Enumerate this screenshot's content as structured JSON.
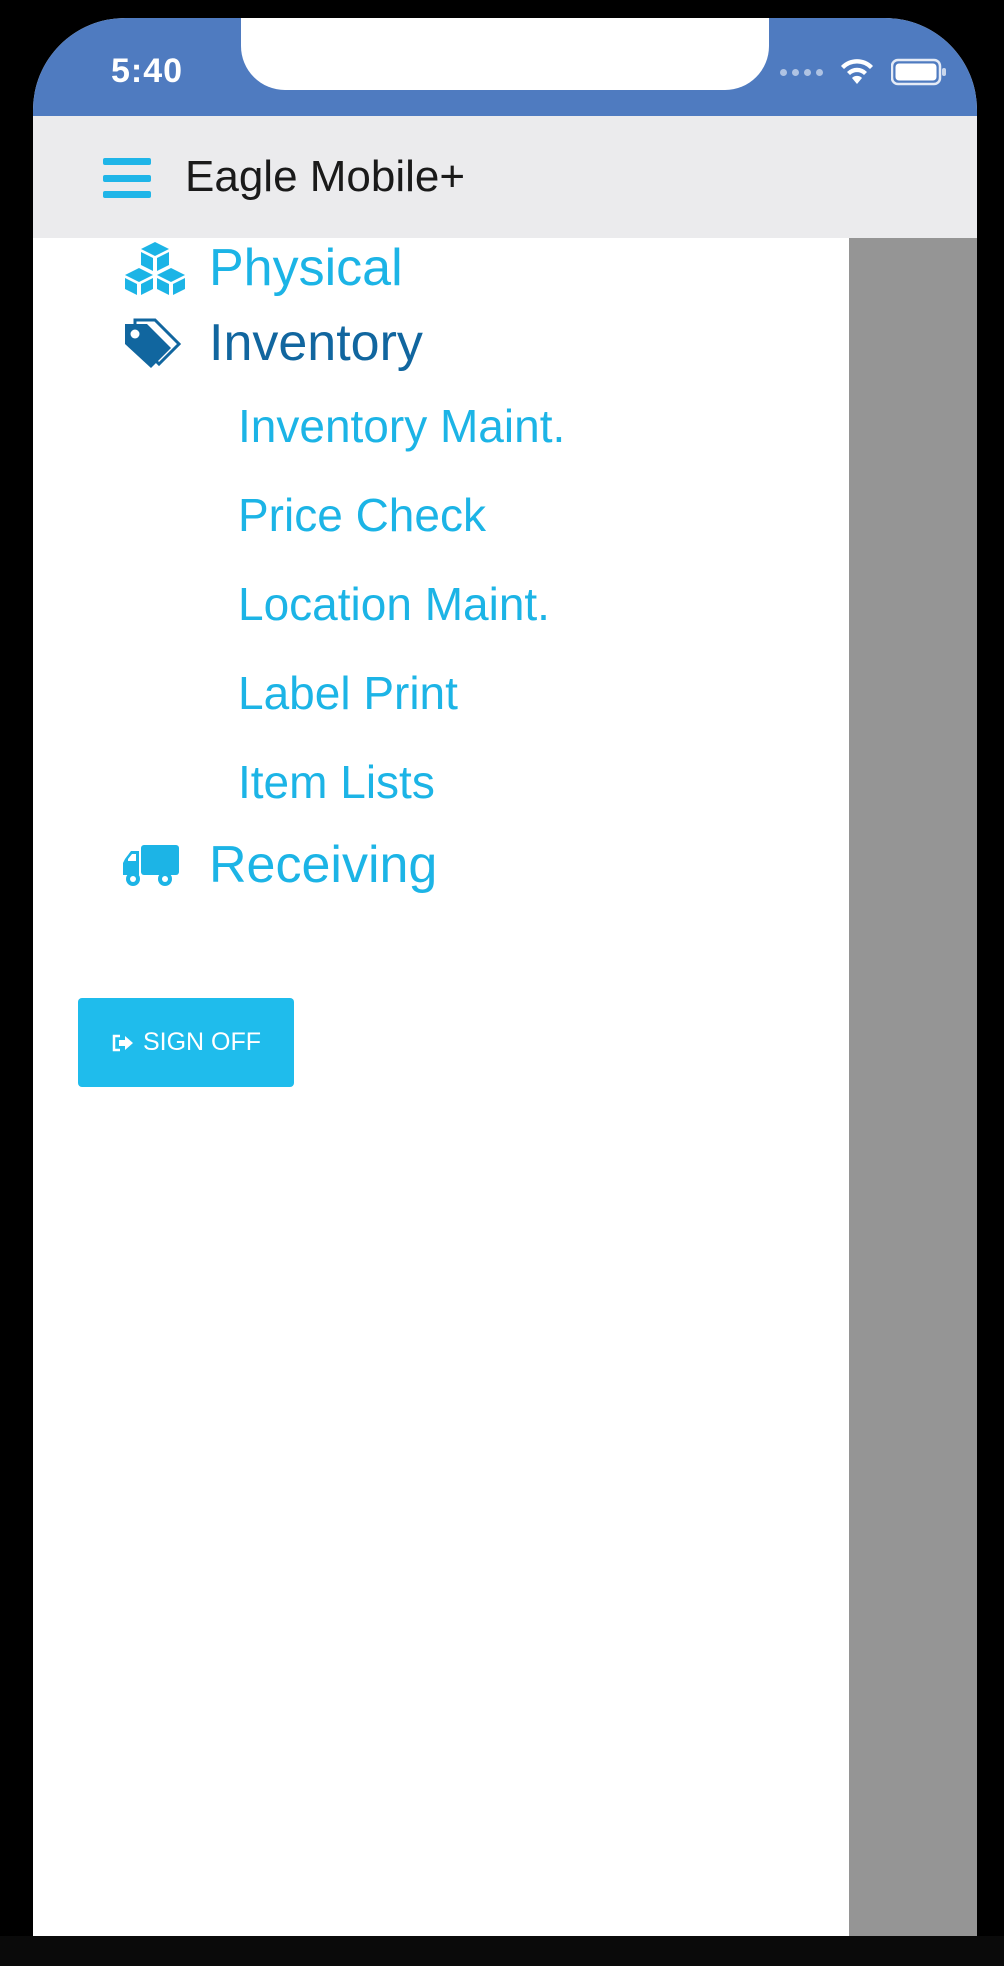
{
  "status_bar": {
    "time": "5:40",
    "background_color": "#4f7bc0",
    "icons": [
      "signal-dots-icon",
      "wifi-icon",
      "battery-icon"
    ]
  },
  "header": {
    "title": "Eagle Mobile+",
    "menu_icon": "hamburger-menu-icon"
  },
  "menu": {
    "items": [
      {
        "label": "Physical",
        "icon": "cubes-icon",
        "active": false
      },
      {
        "label": "Inventory",
        "icon": "tags-icon",
        "active": true,
        "subitems": [
          "Inventory Maint.",
          "Price Check",
          "Location Maint.",
          "Label Print",
          "Item Lists"
        ]
      },
      {
        "label": "Receiving",
        "icon": "truck-icon",
        "active": false
      }
    ]
  },
  "sign_off": {
    "label": "SIGN OFF",
    "icon": "sign-out-icon"
  },
  "colors": {
    "accent": "#1cb4e6",
    "active": "#11669f",
    "header_bg": "#ebebed",
    "backdrop": "#959595"
  }
}
